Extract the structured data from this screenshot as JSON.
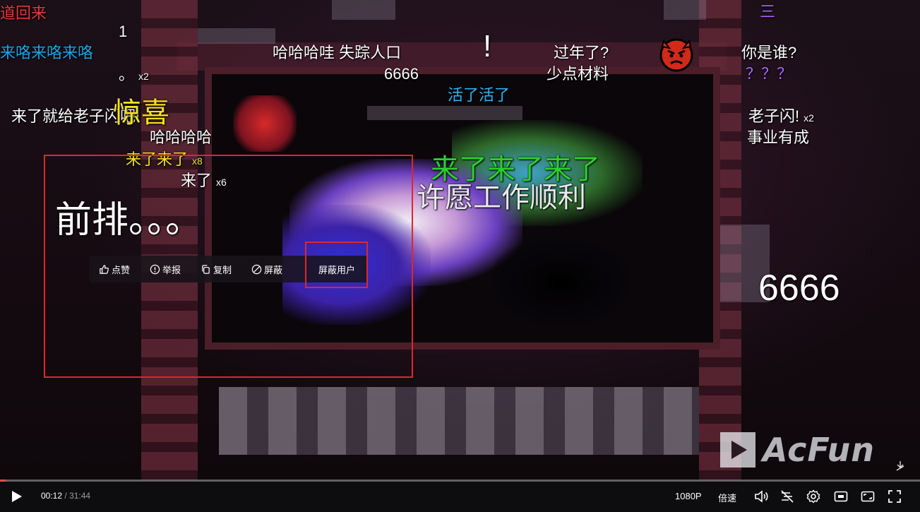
{
  "danmaku": [
    {
      "text": "道回来",
      "color": "#e33a3a"
    },
    {
      "text": "1"
    },
    {
      "text": "来咯来咯来咯",
      "color": "#1aa3e8"
    },
    {
      "text": "。",
      "mult": "x2"
    },
    {
      "text": "来了就给老子闪吧!"
    },
    {
      "text": "惊喜",
      "color": "#f5e11f"
    },
    {
      "text": "哈哈哈哈"
    },
    {
      "text": "来了来了",
      "mult": "x8",
      "color": "#f5e11f"
    },
    {
      "text": "来了",
      "mult": "x6"
    },
    {
      "text": "前排。。。"
    },
    {
      "text": "哈哈哈哇 失踪人口"
    },
    {
      "text": "6666"
    },
    {
      "text": "!"
    },
    {
      "text": "活了活了",
      "color": "#2bb6f5"
    },
    {
      "text": "过年了?"
    },
    {
      "text": "少点材料"
    },
    {
      "text": "三",
      "color": "#b066ff"
    },
    {
      "text": "你是谁?"
    },
    {
      "text": "？？？",
      "color": "#b066ff"
    },
    {
      "text": "老子闪!",
      "mult": "x2"
    },
    {
      "text": "事业有成"
    },
    {
      "text": "来了来了来了",
      "color": "#2bd02b"
    },
    {
      "text": "许愿工作顺利"
    },
    {
      "text": "6666"
    }
  ],
  "danmaku_menu": {
    "like": "点赞",
    "report": "举报",
    "copy": "复制",
    "block": "屏蔽",
    "block_user": "屏蔽用户"
  },
  "watermark": {
    "text": "AcFun"
  },
  "controls": {
    "current_time": "00:12",
    "separator": "/",
    "duration": "31:44",
    "progress": 0.0063,
    "quality": "1080P",
    "speed": "倍速"
  },
  "colors": {
    "highlight": "#e0262a",
    "progress": "#ff4a4a"
  }
}
